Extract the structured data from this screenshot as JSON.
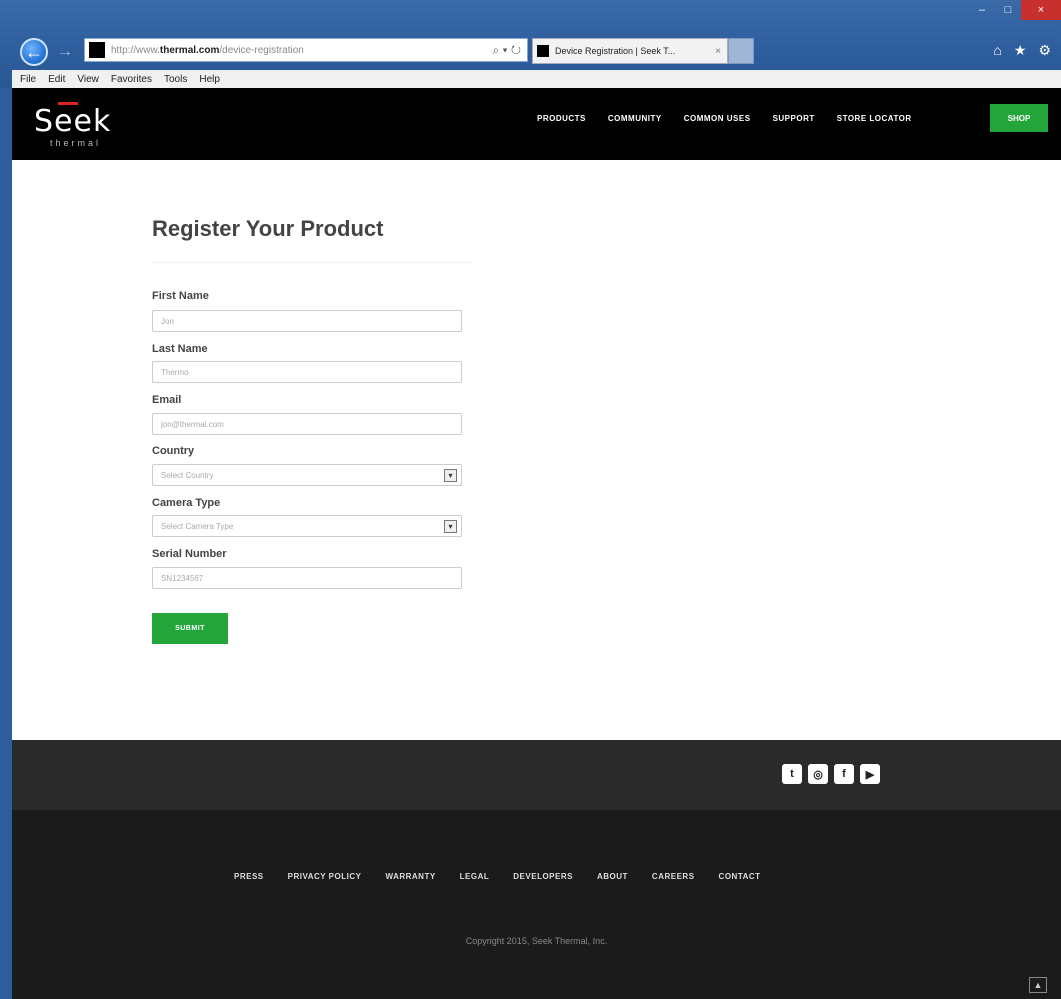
{
  "browser": {
    "url_prefix": "http://www.",
    "url_domain": "thermal.com",
    "url_path": "/device-registration",
    "search_controls": "⌕ ▾ ↻",
    "tab_title": "Device Registration | Seek T...",
    "tab_close": "×",
    "back_icon": "←",
    "forward_icon": "→",
    "minimize": "–",
    "maximize": "□",
    "close": "×",
    "toolbar_icons": {
      "home": "⌂",
      "favorites": "★",
      "tools": "⚙"
    },
    "menu": [
      "File",
      "Edit",
      "View",
      "Favorites",
      "Tools",
      "Help"
    ]
  },
  "header": {
    "logo_text": "Seek",
    "logo_subtext": "thermal",
    "nav": [
      "PRODUCTS",
      "COMMUNITY",
      "COMMON USES",
      "SUPPORT",
      "STORE LOCATOR"
    ],
    "shop_label": "SHOP"
  },
  "form": {
    "title": "Register Your Product",
    "first_name": {
      "label": "First Name",
      "placeholder": "Jon"
    },
    "last_name": {
      "label": "Last Name",
      "placeholder": "Thermo"
    },
    "email": {
      "label": "Email",
      "placeholder": "jon@thermal.com"
    },
    "country": {
      "label": "Country",
      "value": "Select Country"
    },
    "camera_type": {
      "label": "Camera Type",
      "value": "Select Camera Type"
    },
    "serial_number": {
      "label": "Serial Number",
      "placeholder": "SN1234567"
    },
    "select_arrow": "▾",
    "submit_label": "SUBMIT"
  },
  "footer": {
    "social_icons": [
      {
        "name": "twitter",
        "glyph": "t"
      },
      {
        "name": "instagram",
        "glyph": "◎"
      },
      {
        "name": "facebook",
        "glyph": "f"
      },
      {
        "name": "youtube",
        "glyph": "▶"
      }
    ],
    "links": [
      "PRESS",
      "PRIVACY POLICY",
      "WARRANTY",
      "LEGAL",
      "DEVELOPERS",
      "ABOUT",
      "CAREERS",
      "CONTACT"
    ],
    "copyright": "Copyright 2015, Seek Thermal, Inc.",
    "scroll_top": "▲"
  },
  "colors": {
    "accent_green": "#23a53a",
    "header_bg": "#000000",
    "footer_bg": "#1b1b1b"
  }
}
